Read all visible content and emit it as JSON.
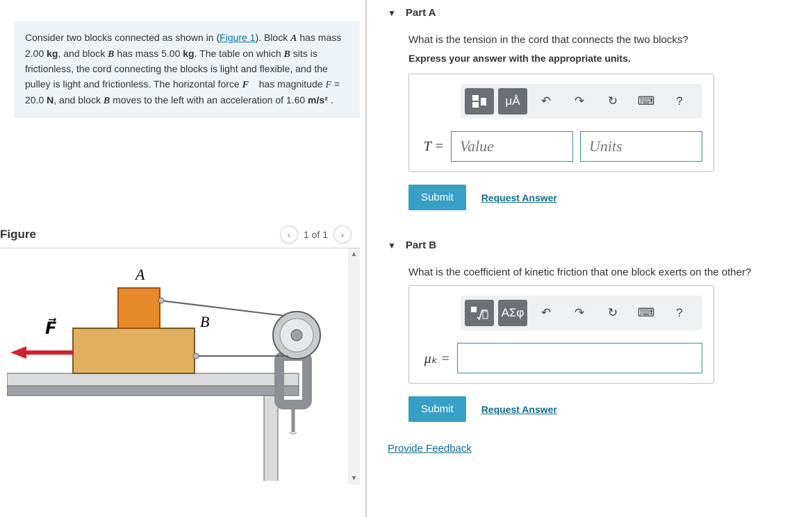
{
  "problem": {
    "text_pre": "Consider two blocks connected as shown in (",
    "figure_link": "Figure 1",
    "text_post1": "). Block ",
    "blockA": "A",
    "text_post2": " has mass 2.00 ",
    "kg1": "kg",
    "text_post3": ", and block ",
    "blockB": "B",
    "text_post4": " has mass 5.00 ",
    "kg2": "kg",
    "text_post5": ". The table on which ",
    "blockB2": "B",
    "text_post6": " sits is frictionless, the cord connecting the blocks is light and flexible, and the pulley is light and frictionless. The horizontal force ",
    "Fvec": "F⃗",
    "text_post7": " has magnitude ",
    "Feq": "F",
    "text_post8": " = 20.0 ",
    "newton": "N",
    "text_post9": ", and block ",
    "blockB3": "B",
    "text_post10": " moves to the left with an acceleration of 1.60 ",
    "accel_unit": "m/s²",
    "text_post11": " ."
  },
  "figure": {
    "heading": "Figure",
    "pager": "1 of 1",
    "labelA": "A",
    "labelB": "B",
    "labelF": "F⃗"
  },
  "partA": {
    "title": "Part A",
    "question": "What is the tension in the cord that connects the two blocks?",
    "instruct": "Express your answer with the appropriate units.",
    "var": "T =",
    "value_ph": "Value",
    "units_ph": "Units",
    "tool_units": "μÅ",
    "submit": "Submit",
    "request": "Request Answer"
  },
  "partB": {
    "title": "Part B",
    "question": "What is the coefficient of kinetic friction that one block exerts on the other?",
    "var": "μₖ =",
    "tool_greek": "ΑΣφ",
    "submit": "Submit",
    "request": "Request Answer"
  },
  "feedback": "Provide Feedback",
  "icons": {
    "undo": "↶",
    "redo": "↷",
    "reset": "↻",
    "keyboard": "⌨",
    "help": "?"
  }
}
